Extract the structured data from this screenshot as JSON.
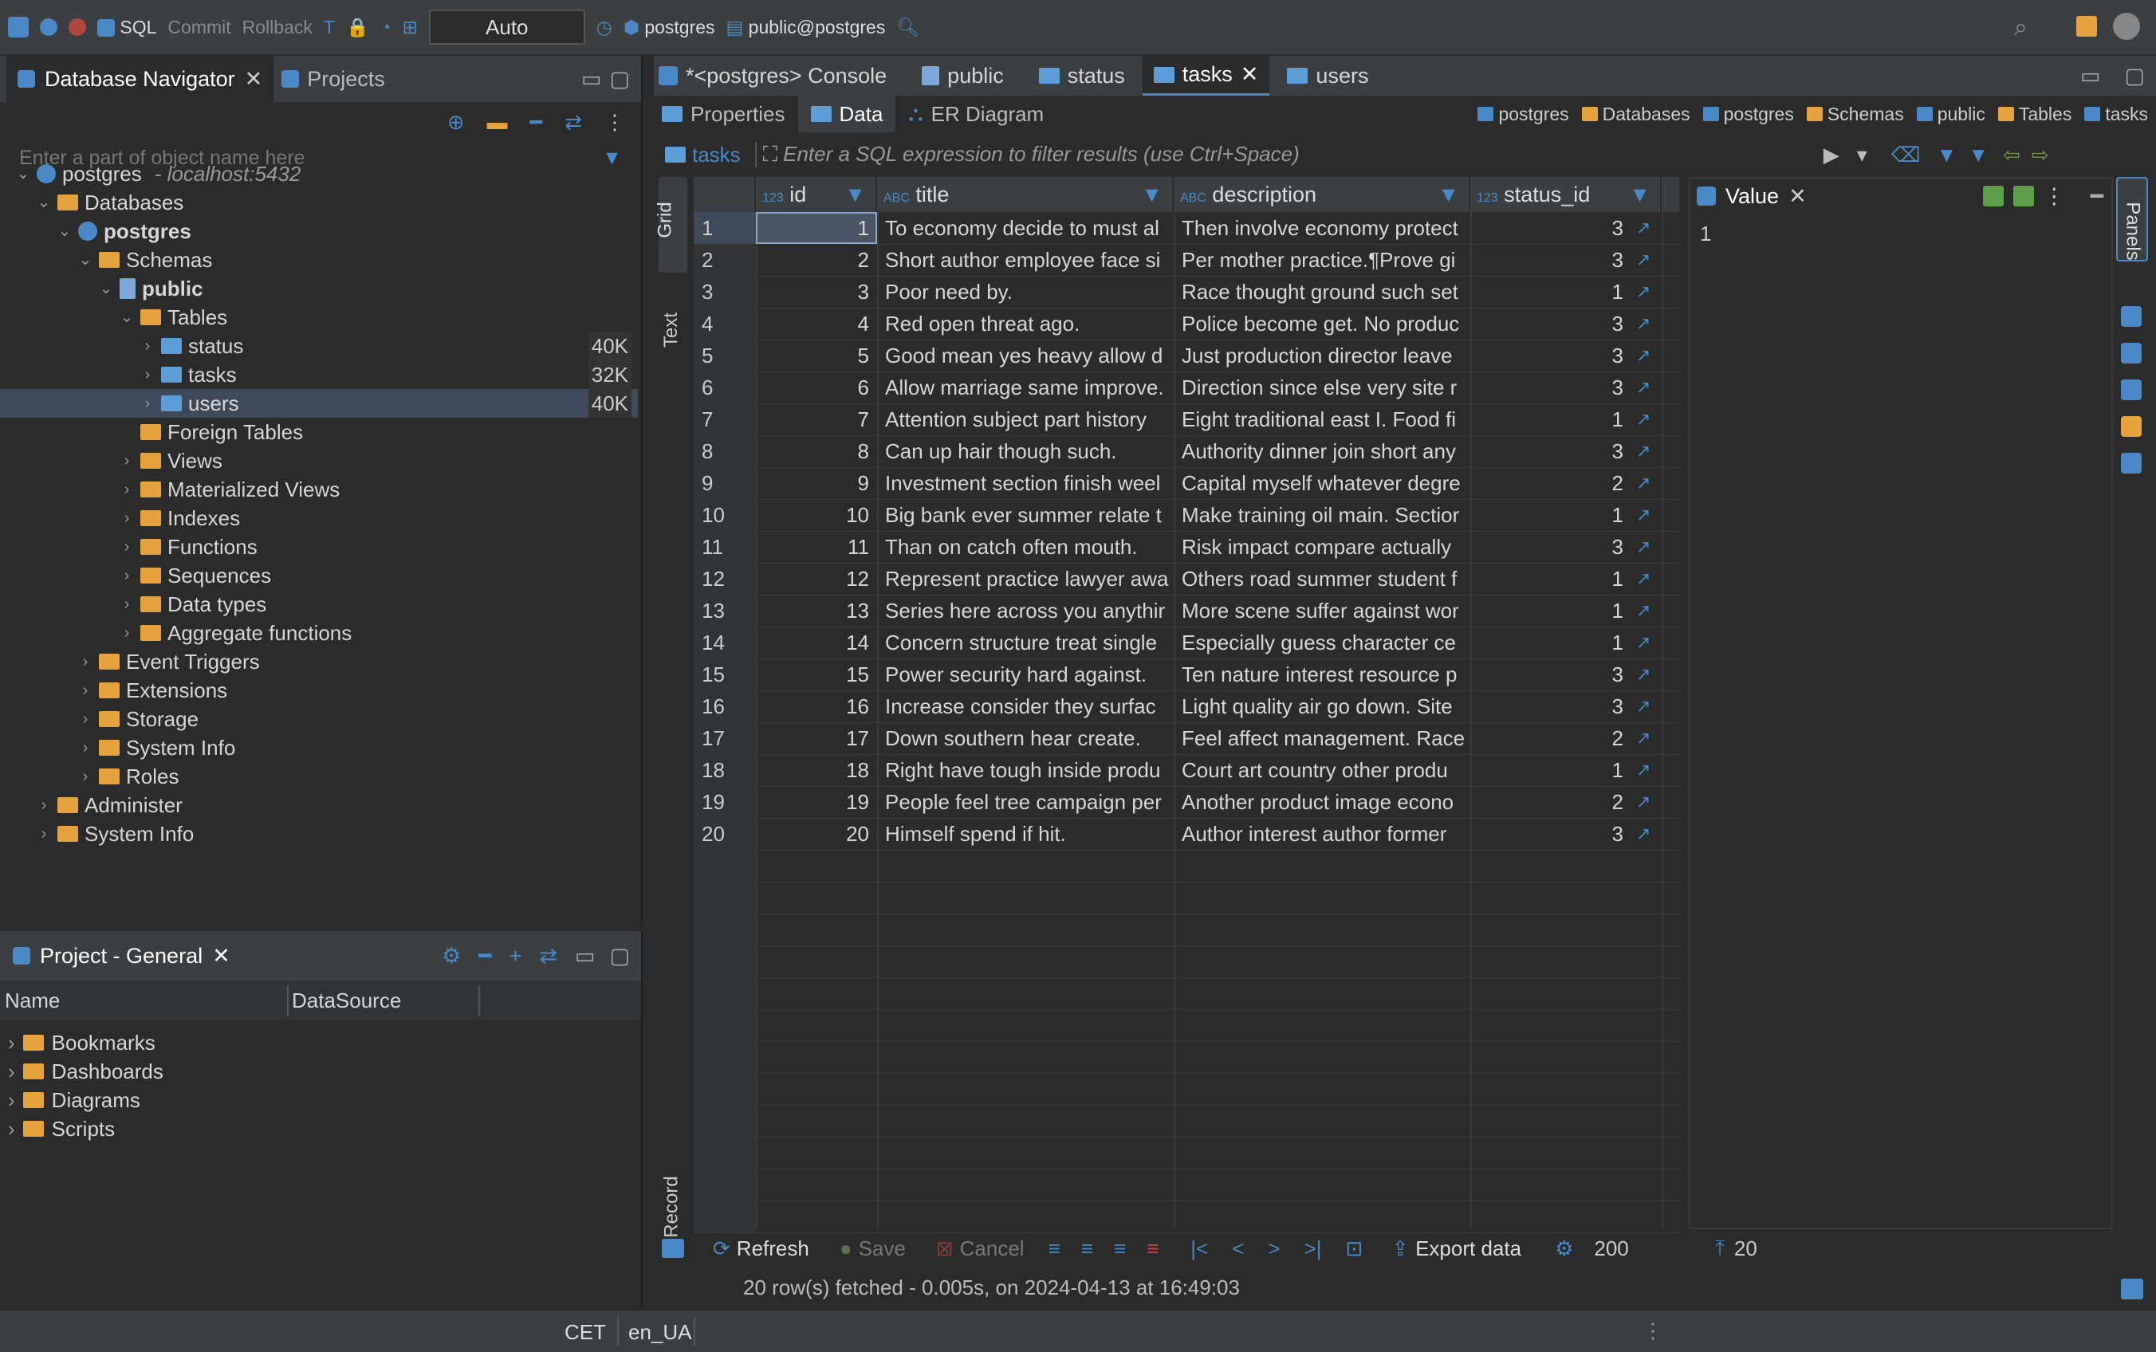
{
  "toolbar": {
    "sql": "SQL",
    "commit": "Commit",
    "rollback": "Rollback",
    "mode": "Auto",
    "conn": "postgres",
    "schema": "public@postgres"
  },
  "nav": {
    "title": "Database Navigator",
    "projects_tab": "Projects",
    "filter_placeholder": "Enter a part of object name here",
    "items": [
      {
        "label": "postgres",
        "extra": "- localhost:5432",
        "level": 0,
        "kind": "db",
        "arrow": "v"
      },
      {
        "label": "Databases",
        "level": 1,
        "kind": "folder",
        "arrow": "v"
      },
      {
        "label": "postgres",
        "level": 2,
        "kind": "db",
        "arrow": "v",
        "bold": true
      },
      {
        "label": "Schemas",
        "level": 3,
        "kind": "folder",
        "arrow": "v"
      },
      {
        "label": "public",
        "level": 4,
        "kind": "schema",
        "arrow": "v",
        "bold": true
      },
      {
        "label": "Tables",
        "level": 5,
        "kind": "folder",
        "arrow": "v"
      },
      {
        "label": "status",
        "level": 6,
        "kind": "table",
        "arrow": ">",
        "size": "40K"
      },
      {
        "label": "tasks",
        "level": 6,
        "kind": "table",
        "arrow": ">",
        "size": "32K"
      },
      {
        "label": "users",
        "level": 6,
        "kind": "table",
        "arrow": ">",
        "size": "40K",
        "selected": true
      },
      {
        "label": "Foreign Tables",
        "level": 5,
        "kind": "folder",
        "arrow": ""
      },
      {
        "label": "Views",
        "level": 5,
        "kind": "folder",
        "arrow": ">"
      },
      {
        "label": "Materialized Views",
        "level": 5,
        "kind": "folder",
        "arrow": ">"
      },
      {
        "label": "Indexes",
        "level": 5,
        "kind": "folder",
        "arrow": ">"
      },
      {
        "label": "Functions",
        "level": 5,
        "kind": "folder",
        "arrow": ">"
      },
      {
        "label": "Sequences",
        "level": 5,
        "kind": "folder",
        "arrow": ">"
      },
      {
        "label": "Data types",
        "level": 5,
        "kind": "folder",
        "arrow": ">"
      },
      {
        "label": "Aggregate functions",
        "level": 5,
        "kind": "folder",
        "arrow": ">"
      },
      {
        "label": "Event Triggers",
        "level": 3,
        "kind": "folder",
        "arrow": ">"
      },
      {
        "label": "Extensions",
        "level": 3,
        "kind": "folder",
        "arrow": ">"
      },
      {
        "label": "Storage",
        "level": 3,
        "kind": "folder",
        "arrow": ">"
      },
      {
        "label": "System Info",
        "level": 3,
        "kind": "folder",
        "arrow": ">"
      },
      {
        "label": "Roles",
        "level": 3,
        "kind": "folder",
        "arrow": ">"
      },
      {
        "label": "Administer",
        "level": 1,
        "kind": "folder",
        "arrow": ">"
      },
      {
        "label": "System Info",
        "level": 1,
        "kind": "folder",
        "arrow": ">"
      }
    ]
  },
  "project": {
    "title": "Project - General",
    "col_name": "Name",
    "col_ds": "DataSource",
    "items": [
      "Bookmarks",
      "Dashboards",
      "Diagrams",
      "Scripts"
    ]
  },
  "editor_tabs": [
    "*<postgres> Console",
    "public",
    "status",
    "tasks",
    "users"
  ],
  "sub_tabs": [
    "Properties",
    "Data",
    "ER Diagram"
  ],
  "breadcrumb": [
    "postgres",
    "Databases",
    "postgres",
    "Schemas",
    "public",
    "Tables",
    "tasks"
  ],
  "filter": {
    "table": "tasks",
    "placeholder": "Enter a SQL expression to filter results (use Ctrl+Space)"
  },
  "side_tabs": {
    "grid": "Grid",
    "text": "Text",
    "record": "Record",
    "panels": "Panels"
  },
  "columns": [
    "id",
    "title",
    "description",
    "status_id"
  ],
  "column_types": [
    "123",
    "ABC",
    "ABC",
    "123"
  ],
  "rows": [
    [
      "1",
      "To economy decide to must al",
      "Then involve economy protect",
      "3"
    ],
    [
      "2",
      "Short author employee face si",
      "Per mother practice.¶Prove gi",
      "3"
    ],
    [
      "3",
      "Poor need by.",
      "Race thought ground such set",
      "1"
    ],
    [
      "4",
      "Red open threat ago.",
      "Police become get. No produc",
      "3"
    ],
    [
      "5",
      "Good mean yes heavy allow d",
      "Just production director leave",
      "3"
    ],
    [
      "6",
      "Allow marriage same improve.",
      "Direction since else very site r",
      "3"
    ],
    [
      "7",
      "Attention subject part history",
      "Eight traditional east I. Food fi",
      "1"
    ],
    [
      "8",
      "Can up hair though such.",
      "Authority dinner join short any",
      "3"
    ],
    [
      "9",
      "Investment section finish weel",
      "Capital myself whatever degre",
      "2"
    ],
    [
      "10",
      "Big bank ever summer relate t",
      "Make training oil main. Sectior",
      "1"
    ],
    [
      "11",
      "Than on catch often mouth.",
      "Risk impact compare actually",
      "3"
    ],
    [
      "12",
      "Represent practice lawyer awa",
      "Others road summer student f",
      "1"
    ],
    [
      "13",
      "Series here across you anythir",
      "More scene suffer against wor",
      "1"
    ],
    [
      "14",
      "Concern structure treat single",
      "Especially guess character ce",
      "1"
    ],
    [
      "15",
      "Power security hard against.",
      "Ten nature interest resource p",
      "3"
    ],
    [
      "16",
      "Increase consider they surfac",
      "Light quality air go down. Site",
      "3"
    ],
    [
      "17",
      "Down southern hear create.",
      "Feel affect management. Race",
      "2"
    ],
    [
      "18",
      "Right have tough inside produ",
      "Court art country other produ",
      "1"
    ],
    [
      "19",
      "People feel tree campaign per",
      "Another product image econo",
      "2"
    ],
    [
      "20",
      "Himself spend if hit.",
      "Author interest author former",
      "3"
    ]
  ],
  "value_panel": {
    "title": "Value",
    "value": "1"
  },
  "bottom": {
    "refresh": "Refresh",
    "save": "Save",
    "cancel": "Cancel",
    "export": "Export data",
    "fetch_size": "200",
    "row_count": "20",
    "status": "20 row(s) fetched - 0.005s, on 2024-04-13 at 16:49:03"
  },
  "statusbar": {
    "tz": "CET",
    "locale": "en_UA"
  }
}
